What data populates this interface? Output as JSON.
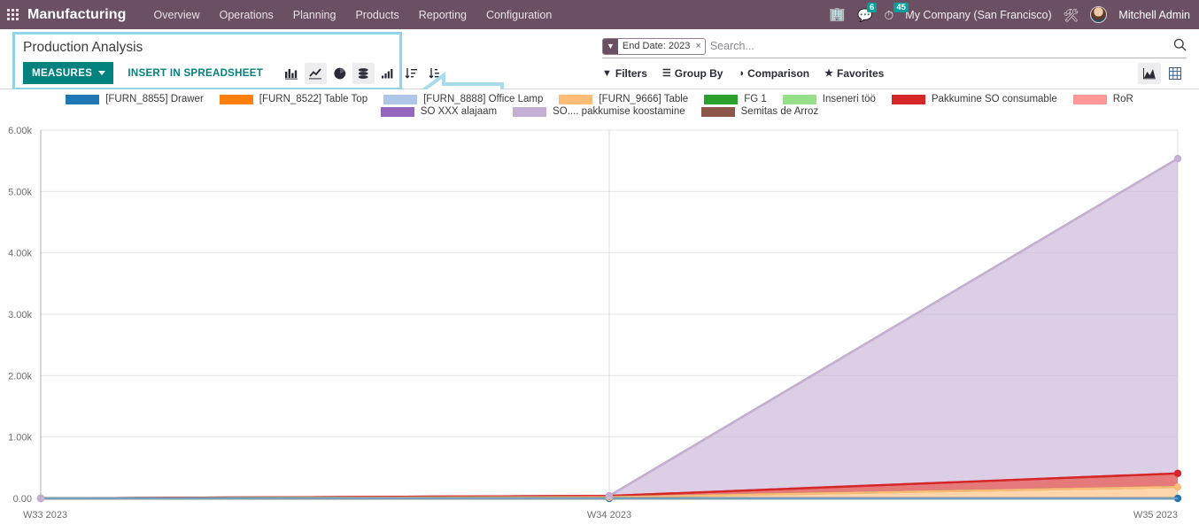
{
  "navbar": {
    "apps_icon": "apps-grid-icon",
    "brand": "Manufacturing",
    "menu": [
      {
        "label": "Overview"
      },
      {
        "label": "Operations"
      },
      {
        "label": "Planning"
      },
      {
        "label": "Products"
      },
      {
        "label": "Reporting"
      },
      {
        "label": "Configuration"
      }
    ],
    "right": {
      "activity_icon": "building-icon",
      "messages_icon": "chat-bubble-icon",
      "messages_count": "6",
      "activities_icon": "clock-icon",
      "activities_count": "45",
      "company": "My Company (San Francisco)",
      "debug_icon": "tools-icon",
      "avatar": "user-avatar",
      "user": "Mitchell Admin"
    }
  },
  "control_panel": {
    "title": "Production Analysis",
    "measures_label": "MEASURES",
    "insert_spreadsheet_label": "INSERT IN SPREADSHEET",
    "chart_buttons": [
      {
        "name": "bar-chart-icon",
        "active": false
      },
      {
        "name": "line-chart-icon",
        "active": true
      },
      {
        "name": "pie-chart-icon",
        "active": false
      },
      {
        "name": "stacked-icon",
        "active": true
      },
      {
        "name": "ascending-bars-icon",
        "active": false
      },
      {
        "name": "sort-descending-icon",
        "active": false
      },
      {
        "name": "sort-ascending-icon",
        "active": false
      }
    ]
  },
  "search": {
    "facet": {
      "icon": "filter-icon",
      "label": "End Date: 2023",
      "remove": "×"
    },
    "placeholder": "Search...",
    "search_icon": "magnifier-icon"
  },
  "filters": [
    {
      "icon": "filter-icon",
      "label": "Filters"
    },
    {
      "icon": "layers-icon",
      "label": "Group By"
    },
    {
      "icon": "contrast-icon",
      "label": "Comparison"
    },
    {
      "icon": "star-icon",
      "label": "Favorites"
    }
  ],
  "view_switch": [
    {
      "name": "graph-view-icon",
      "active": true
    },
    {
      "name": "pivot-view-icon",
      "active": false
    }
  ],
  "chart_data": {
    "type": "area",
    "title": "Production Analysis",
    "xlabel": "",
    "ylabel": "",
    "grid": true,
    "legend_position": "top",
    "categories": [
      "W33 2023",
      "W34 2023",
      "W35 2023"
    ],
    "ylim": [
      0,
      6000
    ],
    "yticks": [
      0,
      1000,
      2000,
      3000,
      4000,
      5000,
      6000
    ],
    "ytick_labels": [
      "0.00",
      "1.00k",
      "2.00k",
      "3.00k",
      "4.00k",
      "5.00k",
      "6.00k"
    ],
    "series": [
      {
        "name": "[FURN_8855] Drawer",
        "color": "#1f77b4",
        "values": [
          0,
          0,
          0
        ]
      },
      {
        "name": "[FURN_8522] Table Top",
        "color": "#ff7f0e",
        "values": [
          0,
          0,
          0
        ]
      },
      {
        "name": "[FURN_8888] Office Lamp",
        "color": "#aec7e8",
        "values": [
          0,
          0,
          0
        ]
      },
      {
        "name": "[FURN_9666] Table",
        "color": "#ffbb78",
        "values": [
          0,
          18,
          185
        ]
      },
      {
        "name": "FG 1",
        "color": "#2ca02c",
        "values": [
          0,
          0,
          0
        ]
      },
      {
        "name": "Inseneri töö",
        "color": "#98df8a",
        "values": [
          0,
          0,
          0
        ]
      },
      {
        "name": "Pakkumine SO consumable",
        "color": "#d62728",
        "values": [
          0,
          22,
          222
        ]
      },
      {
        "name": "RoR",
        "color": "#ff9896",
        "values": [
          0,
          0,
          0
        ]
      },
      {
        "name": "SO XXX alajaam",
        "color": "#9467bd",
        "values": [
          0,
          0,
          0
        ]
      },
      {
        "name": "SO.... pakkumise koostamine",
        "color": "#c5b0d5",
        "values": [
          0,
          0,
          5130
        ]
      },
      {
        "name": "Semitas de Arroz",
        "color": "#8c564b",
        "values": [
          0,
          0,
          0
        ]
      }
    ]
  },
  "annotation": {
    "arrow": "left-arrow-annotation",
    "color": "#a8dcec"
  }
}
